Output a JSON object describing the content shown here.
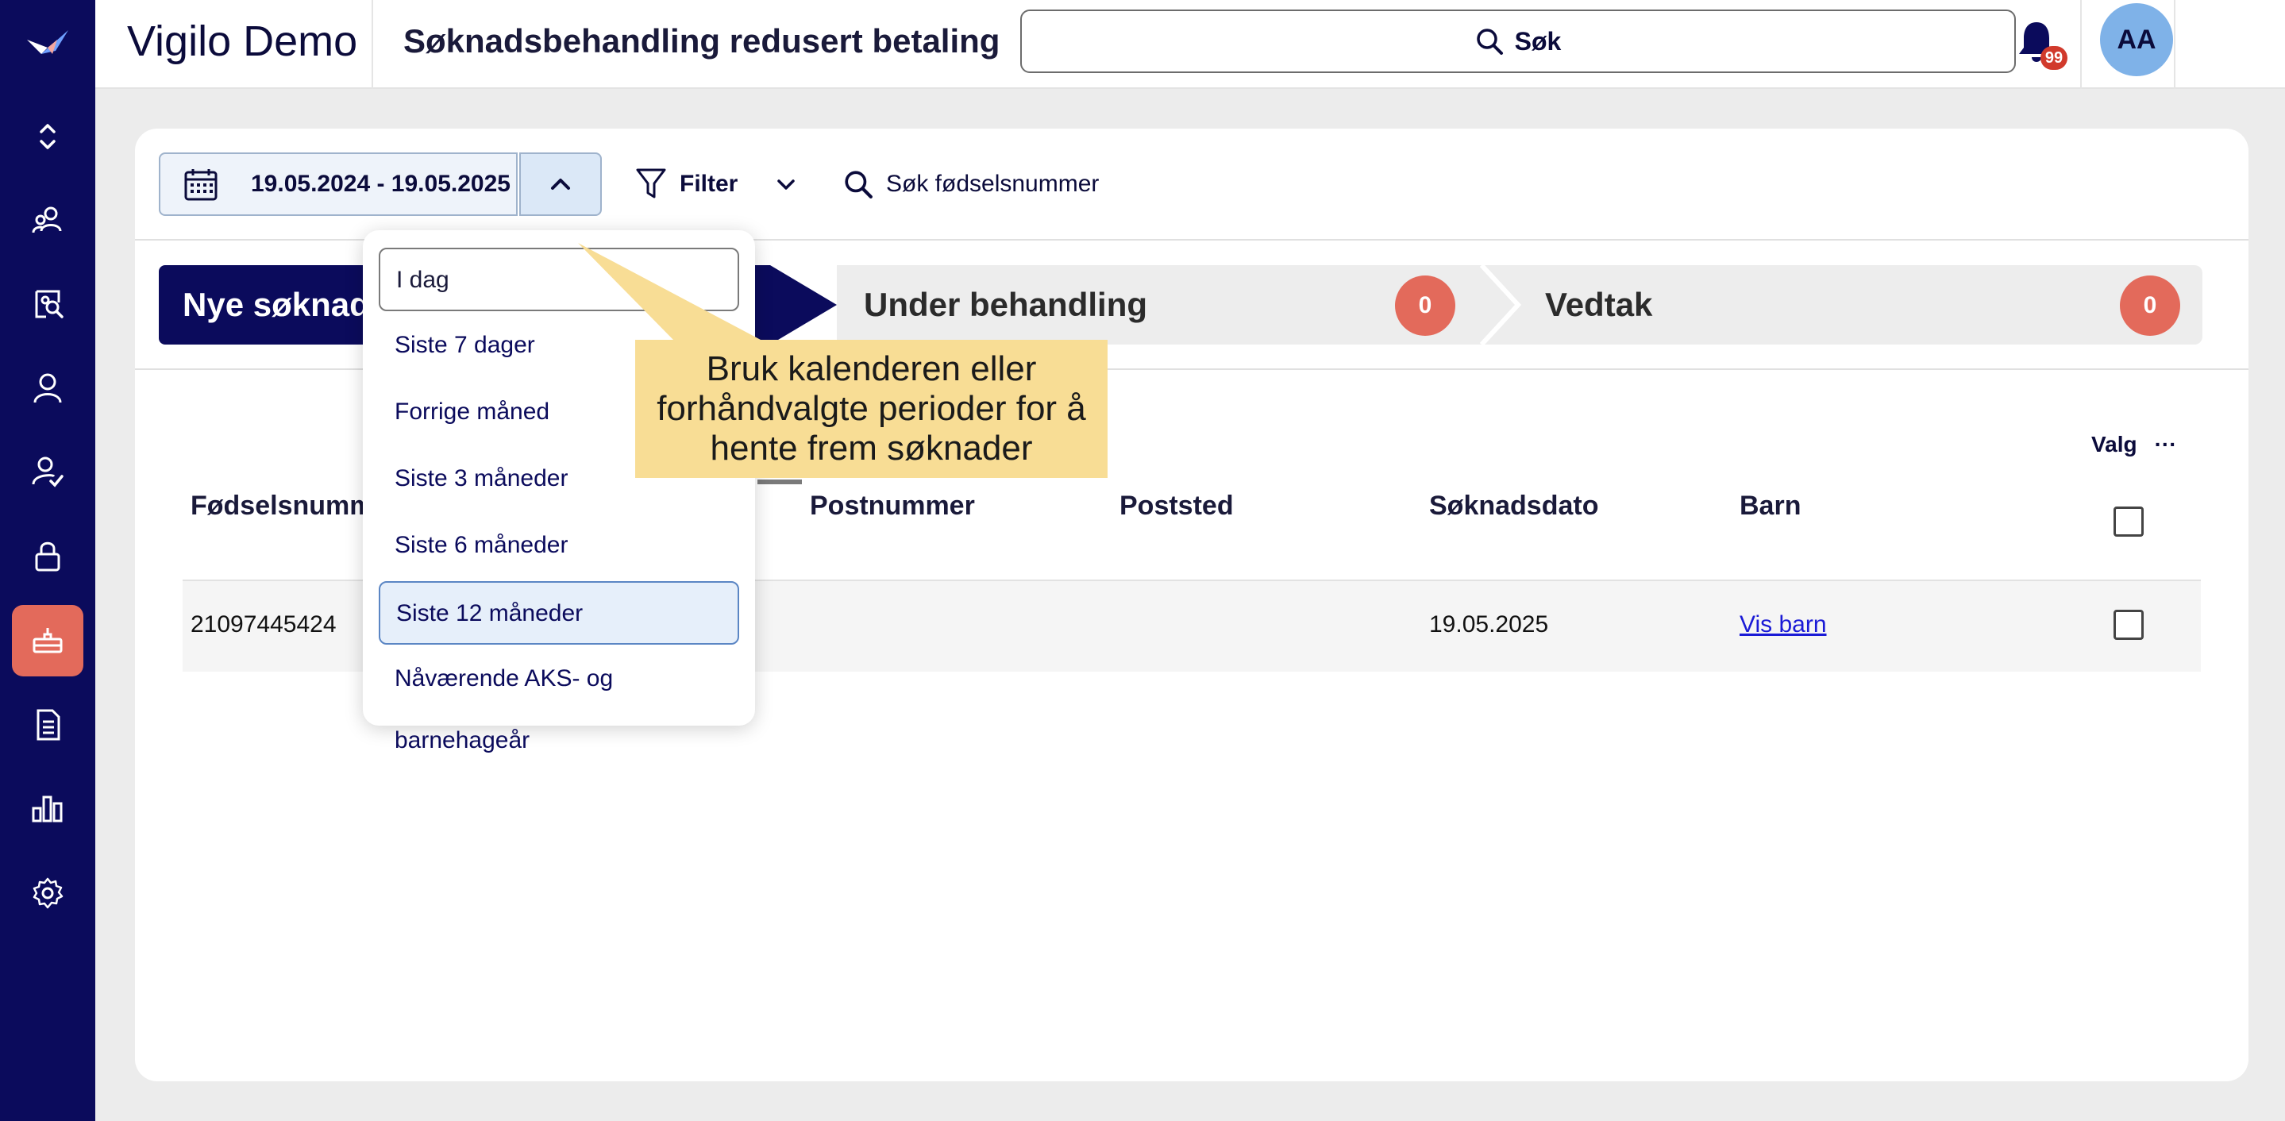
{
  "header": {
    "brand": "Vigilo Demo",
    "title": "Søknadsbehandling redusert betaling",
    "search_label": "Søk",
    "notification_count": "99",
    "avatar_initials": "AA"
  },
  "sidebar": {
    "items": [
      {
        "icon": "expand-collapse-icon"
      },
      {
        "icon": "people-icon"
      },
      {
        "icon": "search-people-icon"
      },
      {
        "icon": "person-icon"
      },
      {
        "icon": "person-check-icon"
      },
      {
        "icon": "lock-icon"
      },
      {
        "icon": "basket-icon",
        "active": true
      },
      {
        "icon": "document-icon"
      },
      {
        "icon": "bar-chart-icon"
      },
      {
        "icon": "gear-icon"
      }
    ],
    "active_color": "#e36a5b"
  },
  "toolbar": {
    "date_range": "19.05.2024 - 19.05.2025",
    "filter_label": "Filter",
    "ssn_search_label": "Søk fødselsnummer"
  },
  "stepper": {
    "steps": [
      {
        "label": "Nye søknader"
      },
      {
        "label": "Under behandling",
        "count": "0"
      },
      {
        "label": "Vedtak",
        "count": "0"
      }
    ]
  },
  "table": {
    "valg_label": "Valg",
    "valg_more": "···",
    "columns": [
      "Fødselsnummer",
      "Postnummer",
      "Poststed",
      "Søknadsdato",
      "Barn"
    ],
    "rows": [
      {
        "fodselsnummer": "21097445424",
        "postnummer": "",
        "poststed": "",
        "soknadsdato": "19.05.2025",
        "barn": "Vis barn"
      }
    ]
  },
  "dropdown": {
    "options": [
      "I dag",
      "Siste 7 dager",
      "Forrige måned",
      "Siste 3 måneder",
      "Siste 6 måneder",
      "Siste 12 måneder",
      "Nåværende AKS- og barnehageår"
    ],
    "selected": "Siste 12 måneder",
    "focused": "I dag"
  },
  "callout": {
    "text": "Bruk kalenderen eller forhåndvalgte perioder for å hente frem søknader"
  },
  "colors": {
    "navy": "#0b0b5c",
    "accent": "#e36a5b",
    "callout": "#f8dd95"
  }
}
